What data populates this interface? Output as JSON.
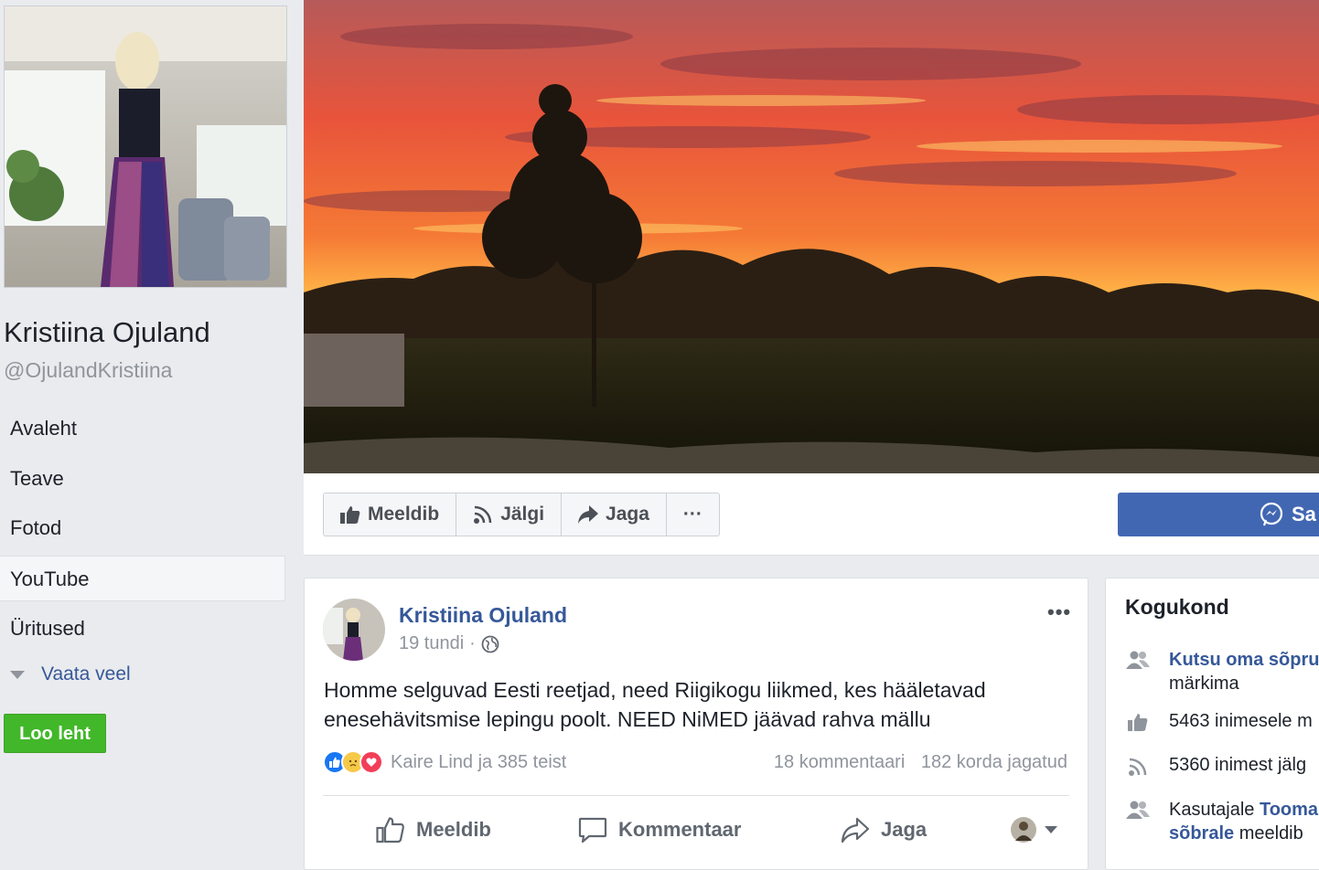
{
  "sidebar": {
    "page_name": "Kristiina Ojuland",
    "handle": "@OjulandKristiina",
    "nav": [
      {
        "label": "Avaleht"
      },
      {
        "label": "Teave"
      },
      {
        "label": "Fotod"
      },
      {
        "label": "YouTube",
        "active": true
      },
      {
        "label": "Üritused"
      }
    ],
    "see_more": "Vaata veel",
    "create_page": "Loo leht"
  },
  "actions": {
    "like": "Meeldib",
    "follow": "Jälgi",
    "share": "Jaga",
    "more": "···",
    "send_message": "Sa"
  },
  "post": {
    "author": "Kristiina Ojuland",
    "time": "19 tundi",
    "separator": "·",
    "text": "Homme selguvad Eesti reetjad, need Riigikogu liikmed, kes hääletavad enesehävitsmise lepingu poolt. NEED NiMED jäävad rahva mällu",
    "reactions_text": "Kaire Lind ja 385 teist",
    "comments": "18 kommentaari",
    "shares": "182 korda jagatud",
    "menu": "•••",
    "like_label": "Meeldib",
    "comment_label": "Kommentaar",
    "share_label": "Jaga"
  },
  "community": {
    "title": "Kogukond",
    "invite_link": "Kutsu oma sõpru",
    "invite_rest": "märkima",
    "likes": "5463 inimesele m",
    "follows": "5360 inimest jälg",
    "friend_prefix": "Kasutajale ",
    "friend_name": "Tooma",
    "friend_link2": "sõbrale",
    "friend_suffix": " meeldib"
  },
  "colors": {
    "brand_blue": "#4267b2",
    "link_blue": "#365899",
    "green": "#42b72a",
    "background": "#e9ebee"
  }
}
